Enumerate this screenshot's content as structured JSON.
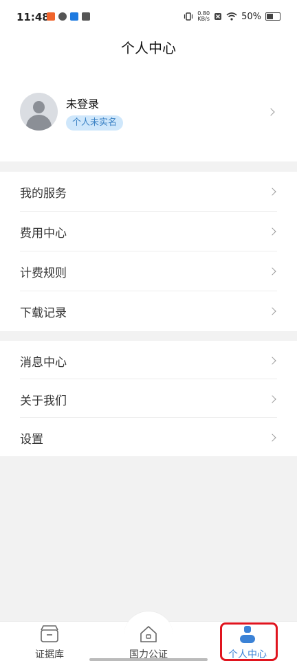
{
  "status_bar": {
    "time": "11:48",
    "net_speed": "0.80",
    "net_unit": "KB/s",
    "battery": "50%",
    "battery_level": 0.5,
    "app_icon_colors": [
      "#f0642c",
      "#555555",
      "#1e7ae0",
      "#555555"
    ]
  },
  "header": {
    "title": "个人中心"
  },
  "profile": {
    "name": "未登录",
    "badge": "个人未实名",
    "avatar_icon": "user-avatar-icon",
    "badge_color": "#cfe7fb",
    "badge_text_color": "#3b82c4"
  },
  "menu_group_1": [
    {
      "label": "我的服务"
    },
    {
      "label": "费用中心"
    },
    {
      "label": "计费规则"
    },
    {
      "label": "下载记录"
    }
  ],
  "menu_group_2": [
    {
      "label": "消息中心"
    },
    {
      "label": "关于我们"
    },
    {
      "label": "设置"
    }
  ],
  "tabbar": {
    "items": [
      {
        "label": "证据库",
        "icon": "archive-box-icon",
        "active": false
      },
      {
        "label": "国力公证",
        "icon": "home-icon",
        "active": false
      },
      {
        "label": "个人中心",
        "icon": "person-icon",
        "active": true
      }
    ],
    "active_color": "#3b82d6",
    "highlight_color": "#e0141e"
  }
}
